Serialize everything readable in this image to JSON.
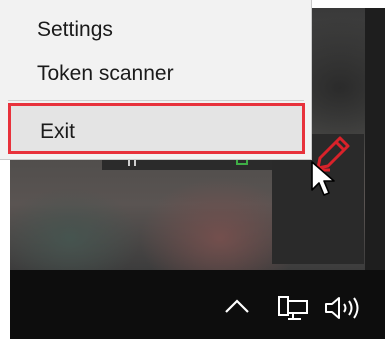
{
  "menu": {
    "items": [
      {
        "label": "Settings"
      },
      {
        "label": "Token scanner"
      },
      {
        "label": "Exit"
      }
    ],
    "highlight_color": "#e8323c"
  },
  "tray": {
    "icons": [
      "chevron-up-icon",
      "network-icon",
      "volume-icon"
    ]
  },
  "desktop": {
    "overlay_icon": "pencil-icon",
    "overlay_icon_color": "#d9222a"
  }
}
